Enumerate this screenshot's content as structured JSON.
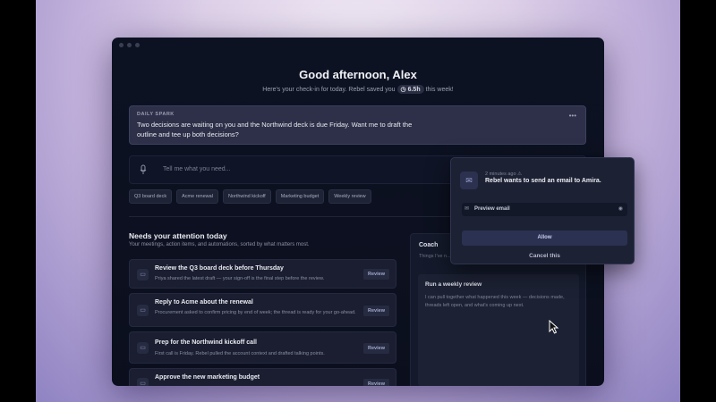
{
  "greeting": "Good afternoon, Alex",
  "subtitle_before": "Here's your check-in for today. Rebel saved you",
  "subtitle_pill": "6.5h",
  "subtitle_after": "this week!",
  "spark": {
    "label": "DAILY SPARK",
    "text": "Two decisions are waiting on you and the Northwind deck is due Friday. Want me to draft the outline and tee up both decisions?"
  },
  "chat": {
    "placeholder": "Tell me what you need...",
    "mic_icon": "microphone-icon"
  },
  "chips": [
    "Q3 board deck",
    "Acme renewal",
    "Northwind kickoff",
    "Marketing budget",
    "Weekly review"
  ],
  "attention": {
    "title": "Needs your attention today",
    "subtitle": "Your meetings, action items, and automations, sorted by what matters most."
  },
  "tasks": [
    {
      "title": "Review the Q3 board deck before Thursday",
      "desc": "Priya shared the latest draft — your sign-off is the final step before the review.",
      "action": "Review"
    },
    {
      "title": "Reply to Acme about the renewal",
      "desc": "Procurement asked to confirm pricing by end of week; the thread is ready for your go-ahead.",
      "action": "Review"
    },
    {
      "title": "Prep for the Northwind kickoff call",
      "desc": "First call is Friday. Rebel pulled the account context and drafted talking points.",
      "action": "Review"
    },
    {
      "title": "Approve the new marketing budget",
      "desc": "",
      "action": "Review"
    }
  ],
  "coach": {
    "title": "Coach",
    "hint": "Things I've n... might be wor...",
    "weekly_title": "Run a weekly review",
    "weekly_text": "I can pull together what happened this week — decisions made, threads left open, and what's coming up next."
  },
  "popup": {
    "time": "2 minutes ago",
    "title": "Rebel wants to send an email to Amira.",
    "preview_label": "Preview email",
    "allow": "Allow",
    "cancel": "Cancel this"
  }
}
